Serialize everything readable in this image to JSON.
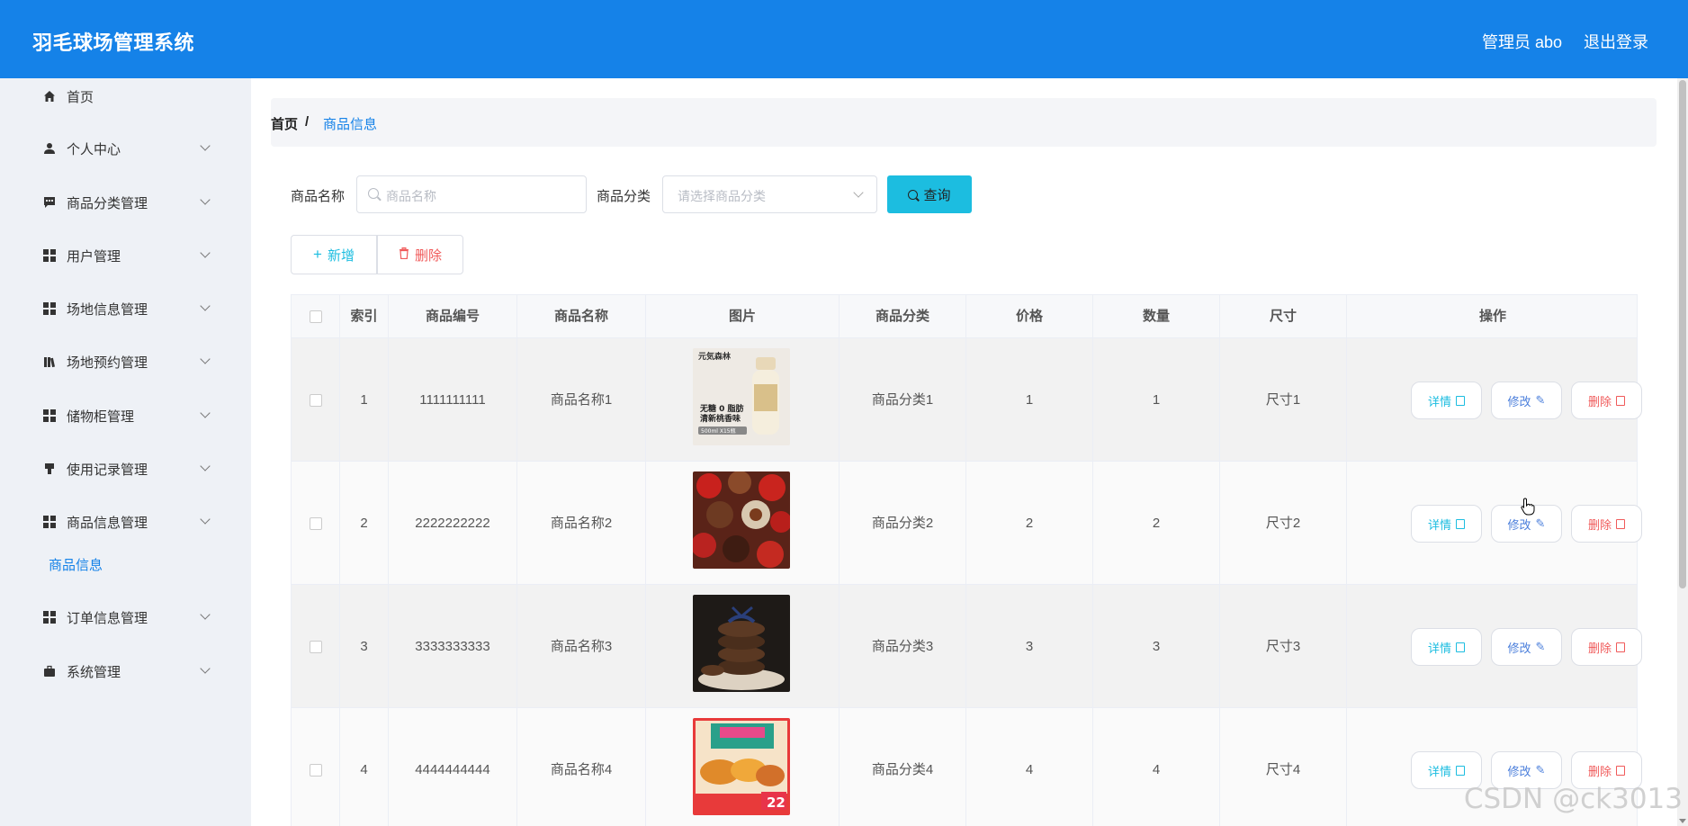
{
  "header": {
    "title": "羽毛球场管理系统",
    "admin": "管理员 abo",
    "logout": "退出登录"
  },
  "sidebar": {
    "items": [
      {
        "label": "首页",
        "icon": "home-icon"
      },
      {
        "label": "个人中心",
        "icon": "user-icon"
      },
      {
        "label": "商品分类管理",
        "icon": "comment-icon"
      },
      {
        "label": "用户管理",
        "icon": "grid-icon"
      },
      {
        "label": "场地信息管理",
        "icon": "grid-icon"
      },
      {
        "label": "场地预约管理",
        "icon": "bookshelf-icon"
      },
      {
        "label": "储物柜管理",
        "icon": "grid-icon"
      },
      {
        "label": "使用记录管理",
        "icon": "stamp-icon"
      },
      {
        "label": "商品信息管理",
        "icon": "grid-icon"
      },
      {
        "label": "订单信息管理",
        "icon": "grid-icon"
      },
      {
        "label": "系统管理",
        "icon": "briefcase-icon"
      }
    ],
    "active_sub": "商品信息"
  },
  "breadcrumb": {
    "home": "首页",
    "sep": "/",
    "current": "商品信息"
  },
  "search": {
    "name_label": "商品名称",
    "name_placeholder": "商品名称",
    "category_label": "商品分类",
    "category_placeholder": "请选择商品分类",
    "query": "查询"
  },
  "actions": {
    "add": "新增",
    "delete": "删除"
  },
  "table": {
    "columns": [
      "索引",
      "商品编号",
      "商品名称",
      "图片",
      "商品分类",
      "价格",
      "数量",
      "尺寸",
      "操作"
    ],
    "rows": [
      {
        "index": "1",
        "code": "1111111111",
        "name": "商品名称1",
        "category": "商品分类1",
        "price": "1",
        "qty": "1",
        "size": "尺寸1",
        "img_text": [
          "元気森林",
          "无糖 0 脂肪",
          "清新桃香味",
          "500ml X15瓶"
        ]
      },
      {
        "index": "2",
        "code": "2222222222",
        "name": "商品名称2",
        "category": "商品分类2",
        "price": "2",
        "qty": "2",
        "size": "尺寸2"
      },
      {
        "index": "3",
        "code": "3333333333",
        "name": "商品名称3",
        "category": "商品分类3",
        "price": "3",
        "qty": "3",
        "size": "尺寸3"
      },
      {
        "index": "4",
        "code": "4444444444",
        "name": "商品名称4",
        "category": "商品分类4",
        "price": "4",
        "qty": "4",
        "size": "尺寸4",
        "img_text": [
          "22"
        ]
      }
    ],
    "op_detail": "详情",
    "op_edit": "修改",
    "op_delete": "删除"
  },
  "watermark": "CSDN @ck3013",
  "colors": {
    "header": "#1582e8",
    "sidebar": "#eef1f6",
    "query": "#1cbde0",
    "danger": "#f05a5a",
    "edit": "#4a7edb"
  }
}
